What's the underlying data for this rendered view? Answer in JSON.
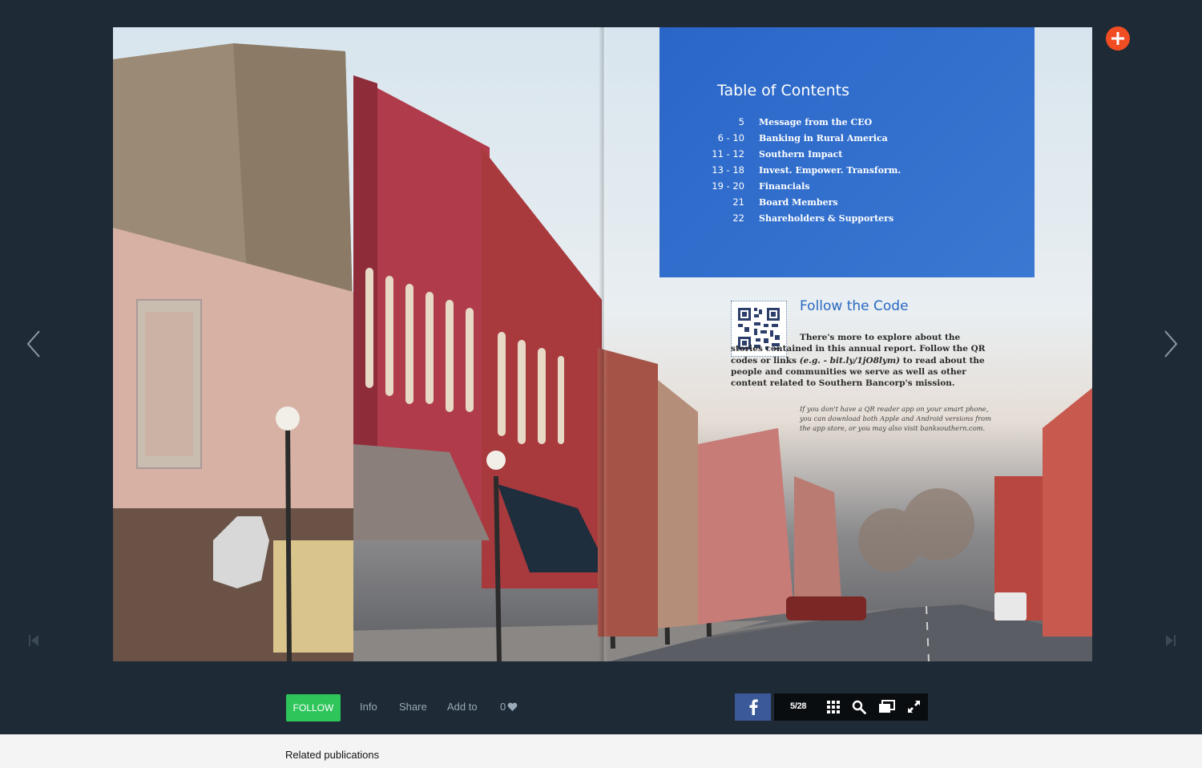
{
  "toc": {
    "title": "Table of Contents",
    "items": [
      {
        "page": "5",
        "label": "Message from the CEO"
      },
      {
        "page": "6 - 10",
        "label": "Banking in Rural America"
      },
      {
        "page": "11 - 12",
        "label": "Southern Impact"
      },
      {
        "page": "13 - 18",
        "label": "Invest. Empower. Transform."
      },
      {
        "page": "19 - 20",
        "label": "Financials"
      },
      {
        "page": "21",
        "label": "Board Members"
      },
      {
        "page": "22",
        "label": "Shareholders & Supporters"
      }
    ]
  },
  "follow_code": {
    "title": "Follow the Code",
    "body_start": "There's more to explore about the stories contained in this annual report. Follow the QR codes or links ",
    "body_example": "(e.g. - bit.ly/1jO8lym)",
    "body_end": " to read about the people and communities we serve as well as other content related to Southern Bancorp's mission.",
    "note": "If you don't have a QR reader app on your smart phone, you can download both Apple and Android versions from the app store, or you may also visit banksouthern.com."
  },
  "toolbar": {
    "follow_label": "FOLLOW",
    "info_label": "Info",
    "share_label": "Share",
    "add_to_label": "Add to",
    "likes_count": "0",
    "page_indicator": "5/28"
  },
  "related": {
    "title": "Related publications"
  },
  "icons": {
    "add": "plus-icon",
    "prev": "chevron-left-icon",
    "next": "chevron-right-icon",
    "first": "skip-first-icon",
    "last": "skip-last-icon",
    "facebook": "facebook-icon",
    "grid": "grid-icon",
    "search": "search-icon",
    "screens": "screens-icon",
    "fullscreen": "fullscreen-icon",
    "heart": "heart-icon"
  },
  "colors": {
    "background": "#1e2a35",
    "follow_green": "#2ec55b",
    "add_orange": "#f04d23",
    "toc_blue": "#2a66c8",
    "facebook_blue": "#3b5998"
  }
}
